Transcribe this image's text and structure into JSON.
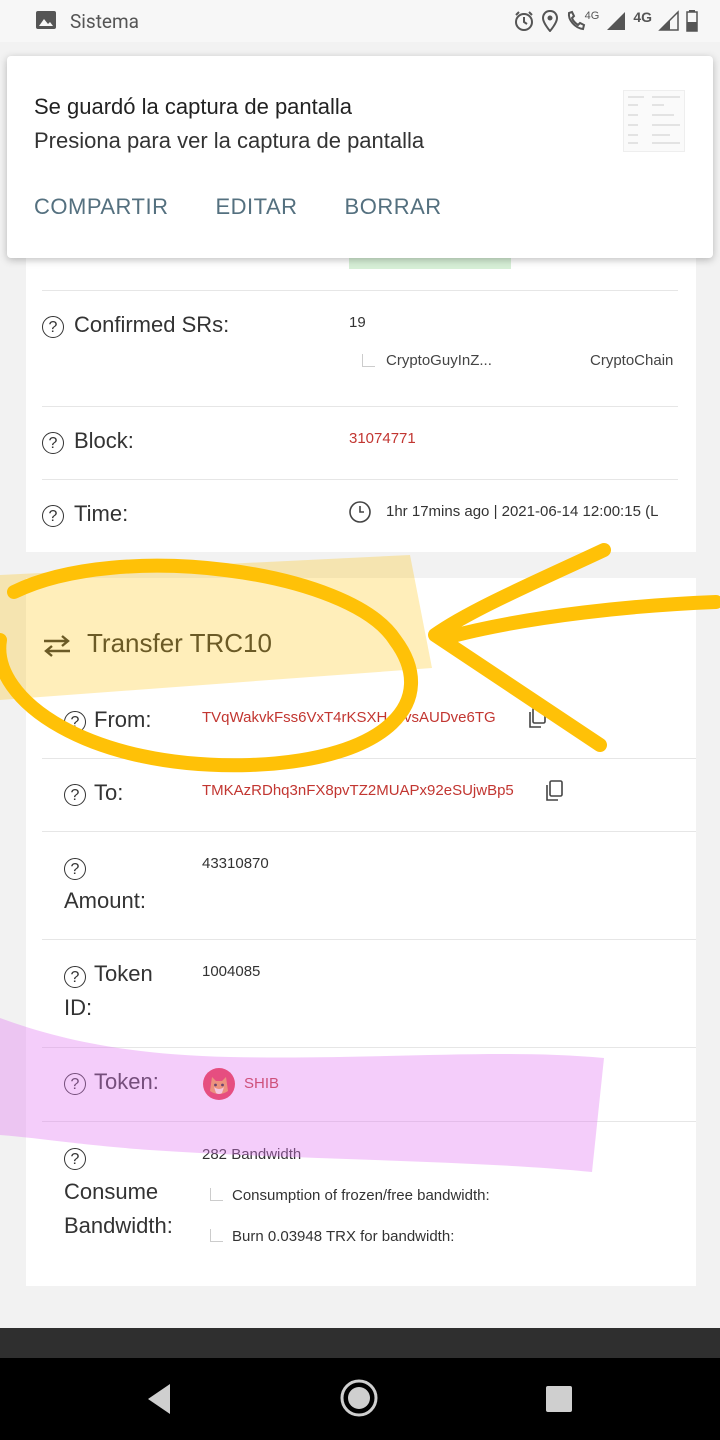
{
  "status_bar": {
    "app_name": "Sistema",
    "network_1": "4G",
    "network_2": "4G"
  },
  "notification": {
    "title": "Se guardó la captura de pantalla",
    "subtitle": "Presiona para ver la captura de pantalla",
    "actions": [
      "COMPARTIR",
      "EDITAR",
      "BORRAR"
    ]
  },
  "block_info": {
    "confirmed_srs": {
      "label": "Confirmed SRs:",
      "count": "19",
      "sr1": "CryptoGuyInZ...",
      "sr2": "CryptoChain"
    },
    "block": {
      "label": "Block:",
      "value": "31074771"
    },
    "time": {
      "label": "Time:",
      "value": "1hr 17mins ago | 2021-06-14 12:00:15 (L"
    }
  },
  "transfer": {
    "title": "Transfer TRC10",
    "from": {
      "label": "From:",
      "value": "TVqWakvkFss6VxT4rKSXH    vsAUDve6TG"
    },
    "to": {
      "label": "To:",
      "value": "TMKAzRDhq3nFX8pvTZ2MUAPx92eSUjwBp5"
    },
    "amount": {
      "label": "Amount:",
      "value": "43310870"
    },
    "token_id": {
      "label_1": "Token",
      "label_2": "ID:",
      "value": "1004085"
    },
    "token": {
      "label": "Token:",
      "value": "SHIB"
    },
    "consume": {
      "label_1": "Consume",
      "label_2": "Bandwidth:",
      "value": "282 Bandwidth",
      "line1": "Consumption of frozen/free bandwidth:",
      "line2": "Burn 0.03948 TRX for bandwidth:"
    }
  },
  "colors": {
    "link_red": "#c23631",
    "highlight_yellow": "#ffc107",
    "highlight_pink": "#f2c4f7"
  },
  "icons": [
    "gallery-icon",
    "alarm-icon",
    "location-icon",
    "wifi-call-icon",
    "signal-icon",
    "battery-icon",
    "question-icon",
    "clock-icon",
    "transfer-icon",
    "copy-icon",
    "shib-token-icon",
    "back-icon",
    "home-icon",
    "recents-icon"
  ]
}
